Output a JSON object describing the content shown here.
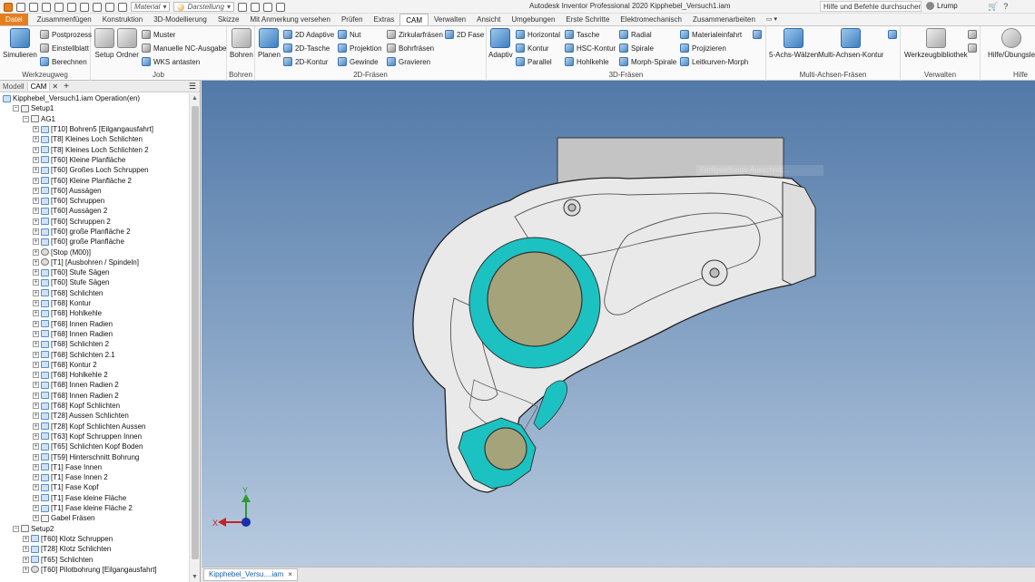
{
  "title_bar": {
    "material_combo": "Material",
    "appearance_combo": "Darstellung",
    "title": "Autodesk Inventor Professional 2020   Kipphebel_Versuch1.iam",
    "search_placeholder": "Hilfe und Befehle durchsuchen...",
    "user": "Lrump",
    "help": "?"
  },
  "menu_tabs": [
    "Datei",
    "Zusammenfügen",
    "Konstruktion",
    "3D-Modellierung",
    "Skizze",
    "Mit Anmerkung versehen",
    "Prüfen",
    "Extras",
    "CAM",
    "Verwalten",
    "Ansicht",
    "Umgebungen",
    "Erste Schritte",
    "Elektromechanisch",
    "Zusammenarbeiten",
    "▭ ▾"
  ],
  "active_tab": "CAM",
  "ribbon": {
    "werkzeugweg": {
      "label": "Werkzeugweg",
      "simulate": "Simulieren",
      "postprocess": "Postprozess",
      "setup_sheet": "Einstellblatt",
      "generate": "Berechnen"
    },
    "job": {
      "label": "Job",
      "setup": "Setup",
      "folder": "Ordner",
      "pattern": "Muster",
      "manual_nc": "Manuelle NC-Ausgabe",
      "wcs_probe": "WKS antasten"
    },
    "drilling": {
      "label": "Bohren",
      "drill": "Bohren"
    },
    "milling_2d": {
      "label": "2D-Fräsen",
      "face": "Planen",
      "adaptive_2d": "2D Adaptive",
      "pocket_2d": "2D-Tasche",
      "contour_2d": "2D-Kontur",
      "slot": "Nut",
      "trace": "Projektion",
      "thread": "Gewinde",
      "circular": "Zirkularfräsen",
      "bore": "Bohrfräsen",
      "engrave": "Gravieren",
      "chamfer_2d": "2D Fase"
    },
    "milling_3d": {
      "label": "3D-Fräsen",
      "adaptive": "Adaptiv",
      "horizontal": "Horizontal",
      "contour": "Kontur",
      "parallel": "Parallel",
      "pocket": "Tasche",
      "scallop": "HSC-Kontur",
      "pencil": "Hohlkehle",
      "radial": "Radial",
      "spiral": "Spirale",
      "morph_spiral": "Morph-Spirale",
      "ramp": "Materialeinfahrt",
      "project": "Projizieren",
      "flow": "Leitkurven-Morph"
    },
    "multiaxis": {
      "label": "Multi-Achsen-Fräsen",
      "swarf": "5-Achs-Wälzen",
      "multiaxis_contour": "Multi-Achsen-Kontur"
    },
    "manage": {
      "label": "Verwalten",
      "tool_library": "Werkzeugbibliothek"
    },
    "help": {
      "label": "Hilfe",
      "tutorials": "Hilfe/Übungsle"
    }
  },
  "browser": {
    "tabs": [
      "Modell",
      "CAM"
    ],
    "rows": [
      {
        "level": 0,
        "exp": "",
        "icon": "assembly",
        "text": "Kipphebel_Versuch1.iam Operation(en)"
      },
      {
        "level": 1,
        "exp": "−",
        "icon": "setup",
        "text": "Setup1"
      },
      {
        "level": 2,
        "exp": "−",
        "icon": "folder",
        "text": "AG1"
      },
      {
        "level": 3,
        "exp": "+",
        "icon": "op",
        "text": "[T10] Bohren5 [Eilgangausfahrt]"
      },
      {
        "level": 3,
        "exp": "+",
        "icon": "op",
        "text": "[T8] Kleines Loch Schlichten"
      },
      {
        "level": 3,
        "exp": "+",
        "icon": "op",
        "text": "[T8] Kleines Loch Schlichten 2"
      },
      {
        "level": 3,
        "exp": "+",
        "icon": "op",
        "text": "[T60] Kleine Planfläche"
      },
      {
        "level": 3,
        "exp": "+",
        "icon": "op",
        "text": "[T60] Großes Loch Schruppen"
      },
      {
        "level": 3,
        "exp": "+",
        "icon": "op",
        "text": "[T60] Kleine Planfläche 2"
      },
      {
        "level": 3,
        "exp": "+",
        "icon": "op",
        "text": "[T60] Aussägen"
      },
      {
        "level": 3,
        "exp": "+",
        "icon": "op",
        "text": "[T60] Schruppen"
      },
      {
        "level": 3,
        "exp": "+",
        "icon": "op",
        "text": "[T60] Aussägen 2"
      },
      {
        "level": 3,
        "exp": "+",
        "icon": "op",
        "text": "[T60] Schruppen 2"
      },
      {
        "level": 3,
        "exp": "+",
        "icon": "op",
        "text": "[T60] große Planfläche 2"
      },
      {
        "level": 3,
        "exp": "+",
        "icon": "op",
        "text": "[T60] große Planfläche"
      },
      {
        "level": 3,
        "exp": "+",
        "icon": "tool",
        "text": "[Stop (M00)]"
      },
      {
        "level": 3,
        "exp": "+",
        "icon": "tool",
        "text": "[T1]   [Ausbohren / Spindeln]"
      },
      {
        "level": 3,
        "exp": "+",
        "icon": "op",
        "text": "[T60] Stufe Sägen"
      },
      {
        "level": 3,
        "exp": "+",
        "icon": "op",
        "text": "[T60] Stufe Sägen"
      },
      {
        "level": 3,
        "exp": "+",
        "icon": "op",
        "text": "[T68] Schlichten"
      },
      {
        "level": 3,
        "exp": "+",
        "icon": "op",
        "text": "[T68] Kontur"
      },
      {
        "level": 3,
        "exp": "+",
        "icon": "op",
        "text": "[T68] Hohlkehle"
      },
      {
        "level": 3,
        "exp": "+",
        "icon": "op",
        "text": "[T68] Innen Radien"
      },
      {
        "level": 3,
        "exp": "+",
        "icon": "op",
        "text": "[T68] Innen Radien"
      },
      {
        "level": 3,
        "exp": "+",
        "icon": "op",
        "text": "[T68] Schlichten 2"
      },
      {
        "level": 3,
        "exp": "+",
        "icon": "op",
        "text": "[T68] Schlichten 2.1"
      },
      {
        "level": 3,
        "exp": "+",
        "icon": "op",
        "text": "[T68] Kontur 2"
      },
      {
        "level": 3,
        "exp": "+",
        "icon": "op",
        "text": "[T68] Hohlkehle 2"
      },
      {
        "level": 3,
        "exp": "+",
        "icon": "op",
        "text": "[T68] Innen Radien 2"
      },
      {
        "level": 3,
        "exp": "+",
        "icon": "op",
        "text": "[T68] Innen Radien 2"
      },
      {
        "level": 3,
        "exp": "+",
        "icon": "op",
        "text": "[T68] Kopf Schlichten"
      },
      {
        "level": 3,
        "exp": "+",
        "icon": "op",
        "text": "[T28] Aussen Schlichten"
      },
      {
        "level": 3,
        "exp": "+",
        "icon": "op",
        "text": "[T28] Kopf Schlichten Aussen"
      },
      {
        "level": 3,
        "exp": "+",
        "icon": "op",
        "text": "[T63] Kopf Schruppen Innen"
      },
      {
        "level": 3,
        "exp": "+",
        "icon": "op",
        "text": "[T65] Schlichten Kopf Boden"
      },
      {
        "level": 3,
        "exp": "+",
        "icon": "op",
        "text": "[T59] Hinterschnitt Bohrung"
      },
      {
        "level": 3,
        "exp": "+",
        "icon": "op",
        "text": "[T1] Fase Innen"
      },
      {
        "level": 3,
        "exp": "+",
        "icon": "op",
        "text": "[T1] Fase Innen 2"
      },
      {
        "level": 3,
        "exp": "+",
        "icon": "op",
        "text": "[T1] Fase Kopf"
      },
      {
        "level": 3,
        "exp": "+",
        "icon": "op",
        "text": "[T1] Fase kleine Fläche"
      },
      {
        "level": 3,
        "exp": "+",
        "icon": "op",
        "text": "[T1] Fase kleine Fläche 2"
      },
      {
        "level": 3,
        "exp": "+",
        "icon": "folder",
        "text": "Gabel Fräsen"
      },
      {
        "level": 1,
        "exp": "−",
        "icon": "setup",
        "text": "Setup2"
      },
      {
        "level": 2,
        "exp": "+",
        "icon": "op",
        "text": "[T60] Klotz Schruppen"
      },
      {
        "level": 2,
        "exp": "+",
        "icon": "op",
        "text": "[T28] Klotz Schlichten"
      },
      {
        "level": 2,
        "exp": "+",
        "icon": "op",
        "text": "[T65] Schlichten"
      },
      {
        "level": 2,
        "exp": "+",
        "icon": "tool",
        "text": "[T60] Pilotbohrung [Eilgangausfahrt]"
      }
    ]
  },
  "viewport": {
    "faded_tooltip": "Fertigstellungs-Ausschnitt...",
    "axis_x": "X",
    "axis_y": "Y",
    "colors": {
      "cyan_face": "#1cc2c2",
      "bore_face": "#a5a37a",
      "part_face": "#e9e9e9",
      "stock_block": "#c4c4c4"
    }
  },
  "document_tab": {
    "label": "Kipphebel_Versu....iam",
    "close": "×"
  }
}
